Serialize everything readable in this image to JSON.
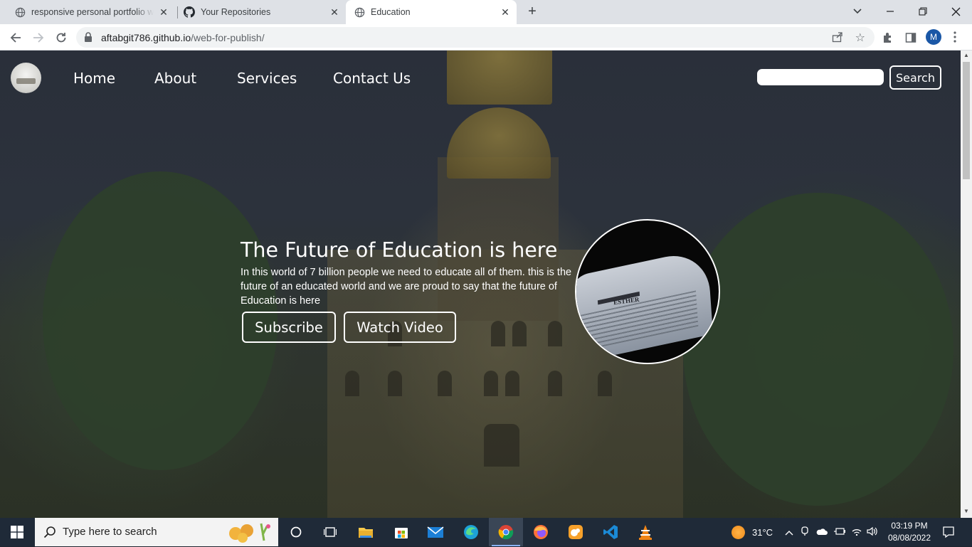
{
  "browser": {
    "tabs": [
      {
        "title": "responsive personal portfolio website",
        "icon": "globe-icon"
      },
      {
        "title": "Your Repositories",
        "icon": "github-icon"
      },
      {
        "title": "Education",
        "icon": "globe-icon",
        "active": true
      }
    ],
    "url_host": "aftabgit786.github.io",
    "url_path": "/web-for-publish/",
    "profile_initial": "M"
  },
  "site": {
    "nav": [
      "Home",
      "About",
      "Services",
      "Contact Us"
    ],
    "search_button": "Search",
    "search_value": "",
    "hero": {
      "title": "The Future of Education is here",
      "text": "In this world of 7 billion people we need to educate all of them. this is the future of an educated world and we are proud to say that the future of Education is here",
      "subscribe": "Subscribe",
      "watch": "Watch Video",
      "image_caption": "ESTHER"
    }
  },
  "taskbar": {
    "search_placeholder": "Type here to search",
    "weather": "31°C",
    "time": "03:19 PM",
    "date": "08/08/2022"
  }
}
